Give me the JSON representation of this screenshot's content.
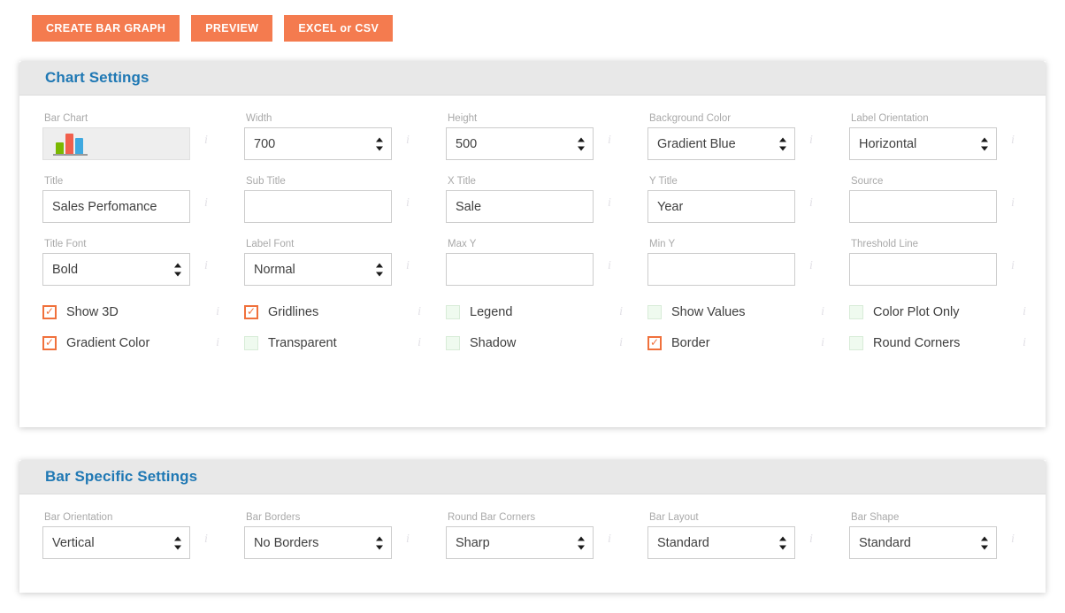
{
  "toolbar": {
    "buttons": [
      {
        "label": "CREATE BAR GRAPH",
        "name": "create-bar-graph-button"
      },
      {
        "label": "PREVIEW",
        "name": "preview-button"
      },
      {
        "label": "EXCEL or CSV",
        "name": "excel-or-csv-button"
      }
    ],
    "accent_color": "#f47b4f"
  },
  "chart_settings": {
    "title": "Chart Settings",
    "heading_color": "#1f78b4",
    "row1": [
      {
        "label": "Bar Chart",
        "type": "swatch",
        "icon": "bar-chart-icon",
        "bars": [
          {
            "color": "#7ab800",
            "height": 14
          },
          {
            "color": "#f15f4c",
            "height": 24
          },
          {
            "color": "#3fa9e0",
            "height": 19
          }
        ],
        "info": "i"
      },
      {
        "label": "Width",
        "type": "stepper",
        "value": "700",
        "info": "i"
      },
      {
        "label": "Height",
        "type": "stepper",
        "value": "500",
        "info": "i"
      },
      {
        "label": "Background Color",
        "type": "select",
        "value": "Gradient Blue",
        "info": "i"
      },
      {
        "label": "Label Orientation",
        "type": "select",
        "value": "Horizontal",
        "info": "i"
      }
    ],
    "row2": [
      {
        "label": "Title",
        "type": "text",
        "value": "Sales Perfomance",
        "placeholder": "",
        "info": "i"
      },
      {
        "label": "Sub Title",
        "type": "text",
        "value": "",
        "placeholder": "",
        "info": "i"
      },
      {
        "label": "X Title",
        "type": "text",
        "value": "Sale",
        "placeholder": "",
        "info": "i"
      },
      {
        "label": "Y Title",
        "type": "text",
        "value": "Year",
        "placeholder": "",
        "info": "i"
      },
      {
        "label": "Source",
        "type": "text",
        "value": "",
        "placeholder": "",
        "info": "i"
      }
    ],
    "row3": [
      {
        "label": "Title Font",
        "type": "select",
        "value": "Bold",
        "info": "i"
      },
      {
        "label": "Label Font",
        "type": "select",
        "value": "Normal",
        "info": "i"
      },
      {
        "label": "Max Y",
        "type": "text",
        "value": "",
        "placeholder": "",
        "info": "i"
      },
      {
        "label": "Min Y",
        "type": "text",
        "value": "",
        "placeholder": "",
        "info": "i"
      },
      {
        "label": "Threshold Line",
        "type": "text",
        "value": "",
        "placeholder": "",
        "info": "i"
      }
    ],
    "checkboxes_row1": [
      {
        "label": "Show 3D",
        "checked": true,
        "info": "i"
      },
      {
        "label": "Gridlines",
        "checked": true,
        "info": "i"
      },
      {
        "label": "Legend",
        "checked": false,
        "info": "i"
      },
      {
        "label": "Show Values",
        "checked": false,
        "info": "i"
      },
      {
        "label": "Color Plot Only",
        "checked": false,
        "info": "i"
      }
    ],
    "checkboxes_row2": [
      {
        "label": "Gradient Color",
        "checked": true,
        "info": "i"
      },
      {
        "label": "Transparent",
        "checked": false,
        "info": "i"
      },
      {
        "label": "Shadow",
        "checked": false,
        "info": "i"
      },
      {
        "label": "Border",
        "checked": true,
        "info": "i"
      },
      {
        "label": "Round Corners",
        "checked": false,
        "info": "i"
      }
    ]
  },
  "bar_settings": {
    "title": "Bar Specific Settings",
    "row1": [
      {
        "label": "Bar Orientation",
        "type": "select",
        "value": "Vertical",
        "info": "i"
      },
      {
        "label": "Bar Borders",
        "type": "select",
        "value": "No Borders",
        "info": "i"
      },
      {
        "label": "Round Bar Corners",
        "type": "select",
        "value": "Sharp",
        "info": "i"
      },
      {
        "label": "Bar Layout",
        "type": "select",
        "value": "Standard",
        "info": "i"
      },
      {
        "label": "Bar Shape",
        "type": "select",
        "value": "Standard",
        "info": "i"
      }
    ]
  }
}
